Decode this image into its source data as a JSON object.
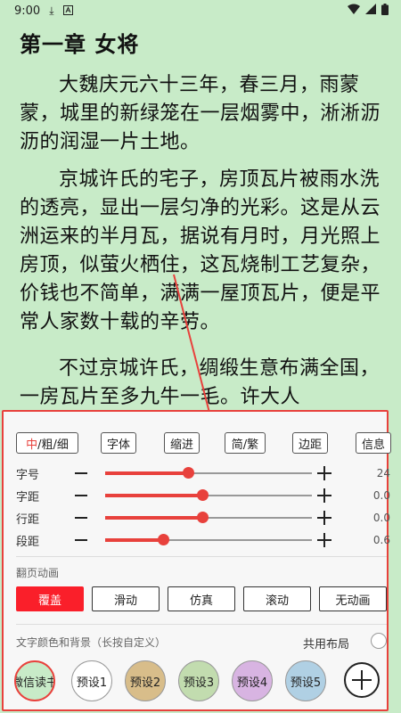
{
  "status_bar": {
    "time": "9:00",
    "icons": [
      "download-icon",
      "a-icon",
      "wifi-icon",
      "signal-icon",
      "battery-icon"
    ]
  },
  "reader": {
    "chapter_title": "第一章 女将",
    "paragraphs": [
      "大魏庆元六十三年，春三月，雨蒙蒙，城里的新绿笼在一层烟雾中，淅淅沥沥的润湿一片土地。",
      "京城许氏的宅子，房顶瓦片被雨水洗的透亮，显出一层匀净的光彩。这是从云洲运来的半月瓦，据说有月时，月光照上房顶，似萤火栖住，这瓦烧制工艺复杂，价钱也不简单，满满一屋顶瓦片，便是平常人家数十载的辛劳。",
      "不过京城许氏，绸缎生意布满全国，一房瓦片至多九牛一毛。许大人"
    ]
  },
  "toolbar": {
    "weight_prefix": "中",
    "weight_rest": "/粗/细",
    "font": "字体",
    "indent": "缩进",
    "simp_trad": "简/繁",
    "margin": "边距",
    "info": "信息"
  },
  "sliders": [
    {
      "label": "字号",
      "value": "24",
      "fraction": 0.4
    },
    {
      "label": "字距",
      "value": "0.0",
      "fraction": 0.47
    },
    {
      "label": "行距",
      "value": "0.0",
      "fraction": 0.47
    },
    {
      "label": "段距",
      "value": "0.6",
      "fraction": 0.28
    }
  ],
  "page_animation": {
    "title": "翻页动画",
    "options": [
      "覆盖",
      "滑动",
      "仿真",
      "滚动",
      "无动画"
    ],
    "selected": "覆盖"
  },
  "themes": {
    "title": "文字颜色和背景（长按自定义）",
    "shared_layout": "共用布局",
    "items": [
      {
        "label": "微信读书",
        "color": "#c8ebc8"
      },
      {
        "label": "预设1",
        "color": "#ffffff"
      },
      {
        "label": "预设2",
        "color": "#d8bd8a"
      },
      {
        "label": "预设3",
        "color": "#c2dcaf"
      },
      {
        "label": "预设4",
        "color": "#d8b4e2"
      },
      {
        "label": "预设5",
        "color": "#b0d0e4"
      }
    ]
  },
  "colors": {
    "accent": "#e8413c",
    "page_background": "#c8ebc8"
  }
}
